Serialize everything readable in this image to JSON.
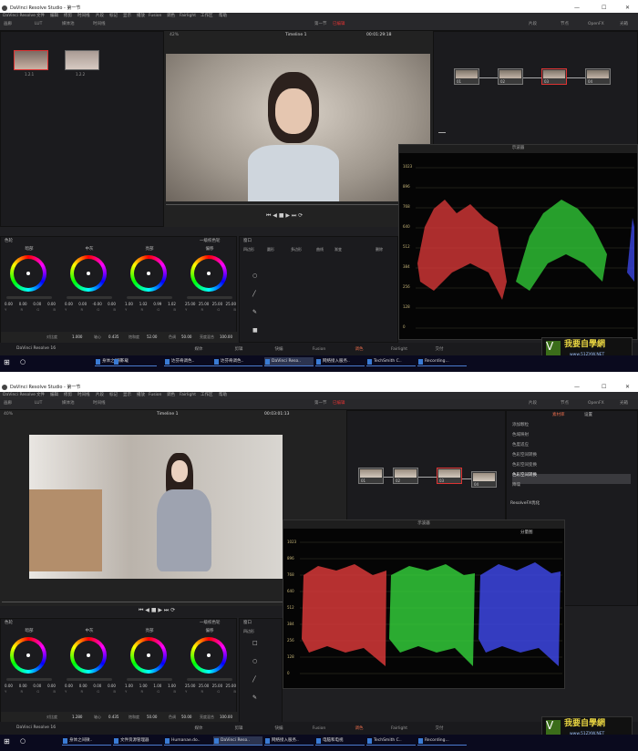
{
  "app_title": "DaVinci Resolve Studio - 第一节",
  "menu": [
    "DaVinci Resolve",
    "文件",
    "编辑",
    "修剪",
    "时间线",
    "片段",
    "标记",
    "显示",
    "播放",
    "Fusion",
    "调色",
    "Fairlight",
    "工作区",
    "帮助"
  ],
  "toolbar": {
    "gallery": "画廊",
    "lut": "LUT",
    "media_pool": "媒体池",
    "clips": "时间线",
    "project_name": "第一节",
    "edited": "已编辑",
    "clips_btn": "片段",
    "nodes": "节点",
    "openfx": "OpenFX",
    "lightbox": "光箱"
  },
  "s1": {
    "zoom": "42%",
    "timeline": "Timeline 1",
    "timecode": "00:01:29:18",
    "thumbs": [
      "1.2.1",
      "1.2.2"
    ],
    "nodes": [
      "01",
      "02",
      "03",
      "04"
    ],
    "scope_title": "示波器",
    "scope_ticks": [
      "1023",
      "896",
      "768",
      "640",
      "512",
      "384",
      "256",
      "128",
      "0"
    ],
    "color_panel_title": "色轮",
    "primaries": "一级校色轮",
    "window_title": "窗口",
    "window_tools": [
      "四边形",
      "圆形",
      "多边形",
      "曲线",
      "渐变",
      "删除"
    ],
    "wheels": [
      {
        "name": "暗部",
        "vals": [
          "0.00",
          "0.00",
          "0.00",
          "0.00"
        ]
      },
      {
        "name": "中灰",
        "vals": [
          "0.00",
          "0.00",
          "-0.00",
          "0.00"
        ]
      },
      {
        "name": "亮部",
        "vals": [
          "1.00",
          "1.02",
          "0.99",
          "1.02"
        ]
      },
      {
        "name": "偏移",
        "vals": [
          "25.00",
          "25.00",
          "25.00",
          "25.00"
        ]
      }
    ],
    "wheel_letters": [
      "Y",
      "R",
      "G",
      "B"
    ],
    "bottom": {
      "contrast_label": "对比度",
      "contrast": "1.000",
      "pivot_label": "轴心",
      "pivot": "0.435",
      "sat_label": "饱和度",
      "sat": "52.00",
      "hue_label": "色调",
      "hue": "50.00",
      "lum_label": "亮度混合",
      "lum": "100.00"
    },
    "app_name": "DaVinci Resolve 16",
    "pages": [
      "媒体",
      "剪辑",
      "快编",
      "Fusion",
      "调色",
      "Fairlight",
      "交付"
    ]
  },
  "s2": {
    "zoom": "40%",
    "timeline": "Timeline 1",
    "timecode": "00:03:01:13",
    "nodes": [
      "01",
      "02",
      "03",
      "04"
    ],
    "scope_title": "示波器",
    "scope_mode": "分量图",
    "scope_ticks": [
      "1023",
      "896",
      "768",
      "640",
      "512",
      "384",
      "256",
      "128",
      "0"
    ],
    "fx_tabs": [
      "素材库",
      "设置"
    ],
    "fx_items": [
      "添加颗粒",
      "色域映射",
      "色度适应",
      "色彩空间转换",
      "色彩空间变换",
      "色彩空间转换",
      "降噪"
    ],
    "resolvefx_label": "ResolveFX优化",
    "wheels": [
      {
        "name": "暗部",
        "vals": [
          "0.00",
          "0.00",
          "0.00",
          "0.00"
        ]
      },
      {
        "name": "中灰",
        "vals": [
          "0.00",
          "0.00",
          "0.00",
          "0.00"
        ]
      },
      {
        "name": "亮部",
        "vals": [
          "1.00",
          "1.00",
          "1.00",
          "1.00"
        ]
      },
      {
        "name": "偏移",
        "vals": [
          "25.00",
          "25.00",
          "25.00",
          "25.00"
        ]
      }
    ],
    "bottom": {
      "contrast_label": "对比度",
      "contrast": "1.280",
      "pivot_label": "轴心",
      "pivot": "0.435",
      "sat_label": "饱和度",
      "sat": "50.00",
      "hue_label": "色调",
      "hue": "50.00",
      "lum_label": "亮度混合",
      "lum": "100.00"
    },
    "window_tools": [
      "四边形",
      "圆形",
      "多边形",
      "曲线",
      "渐变"
    ]
  },
  "taskbar1": [
    "身体之间微..",
    "下载",
    "达芬奇调色..",
    "达芬奇调色..",
    "DaVinci Reso..",
    "网络接入服务..",
    "TechSmith C..",
    "Recording..."
  ],
  "taskbar2": [
    "身体之间微..",
    "文件资源管理器",
    "Humanae.do..",
    "DaVinci Reso..",
    "网络接入服务..",
    "电脑和电视",
    "TechSmith C..",
    "Recording..."
  ],
  "watermark": {
    "text": "我要自學網",
    "url": "www.51ZXW.NET"
  }
}
